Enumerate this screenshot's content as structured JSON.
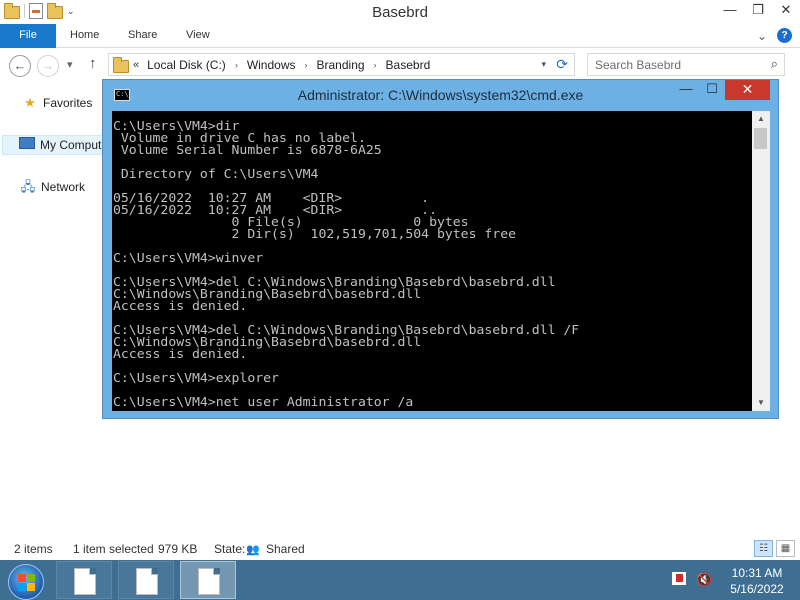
{
  "explorer": {
    "title": "Basebrd",
    "window_controls": {
      "minimize": "—",
      "maximize": "❐",
      "close": "✕"
    },
    "quick_access": [
      "folder-icon",
      "properties-icon",
      "new-folder-icon"
    ],
    "ribbon": {
      "tabs": [
        "File",
        "Home",
        "Share",
        "View"
      ],
      "expand_glyph": "⌄",
      "help_glyph": "?"
    },
    "nav": {
      "back": "←",
      "forward": "→",
      "recent_glyph": "▾",
      "up": "↑"
    },
    "address": {
      "overflow": "«",
      "separator": "›",
      "breadcrumbs": [
        "Local Disk (C:)",
        "Windows",
        "Branding",
        "Basebrd"
      ],
      "dropdown_glyph": "▾",
      "refresh_glyph": "⟳"
    },
    "search": {
      "placeholder": "Search Basebrd",
      "icon": "⌕"
    },
    "navpane": {
      "items": [
        {
          "label": "Favorites",
          "icon": "star-icon"
        },
        {
          "label": "My Computer",
          "icon": "computer-icon"
        },
        {
          "label": "Network",
          "icon": "network-icon"
        }
      ]
    },
    "status": {
      "items_count": "2 items",
      "selected": "1 item selected",
      "size": "979 KB",
      "state_label": "State:",
      "state_value": "Shared",
      "details_view": "☷",
      "icons_view": "▦"
    }
  },
  "cmd": {
    "title": "Administrator: C:\\Windows\\system32\\cmd.exe",
    "icon_text": "C:\\_",
    "controls": {
      "minimize": "—",
      "maximize": "☐",
      "close": "✕"
    },
    "lines": [
      "C:\\Users\\VM4>dir",
      " Volume in drive C has no label.",
      " Volume Serial Number is 6878-6A25",
      "",
      " Directory of C:\\Users\\VM4",
      "",
      "05/16/2022  10:27 AM    <DIR>          .",
      "05/16/2022  10:27 AM    <DIR>          ..",
      "               0 File(s)              0 bytes",
      "               2 Dir(s)  102,519,701,504 bytes free",
      "",
      "C:\\Users\\VM4>winver",
      "",
      "C:\\Users\\VM4>del C:\\Windows\\Branding\\Basebrd\\basebrd.dll",
      "C:\\Windows\\Branding\\Basebrd\\basebrd.dll",
      "Access is denied.",
      "",
      "C:\\Users\\VM4>del C:\\Windows\\Branding\\Basebrd\\basebrd.dll /F",
      "C:\\Windows\\Branding\\Basebrd\\basebrd.dll",
      "Access is denied.",
      "",
      "C:\\Users\\VM4>explorer",
      "",
      "C:\\Users\\VM4>net user Administrator /a"
    ],
    "scroll_up": "▲",
    "scroll_down": "▼"
  },
  "taskbar": {
    "apps": [
      "document-app-1",
      "document-app-2",
      "document-app-3"
    ],
    "tray": {
      "flag_icon": "action-center-flag-icon",
      "speaker_glyph": "🔇"
    },
    "clock": {
      "time": "10:31 AM",
      "date": "5/16/2022"
    }
  },
  "colors": {
    "file_tab": "#1979ca",
    "cmd_frame": "#6db0e3",
    "cmd_close": "#c8392c",
    "console_bg": "#000000",
    "console_fg": "#c0c0c0",
    "taskbar": "#3e6f93"
  }
}
